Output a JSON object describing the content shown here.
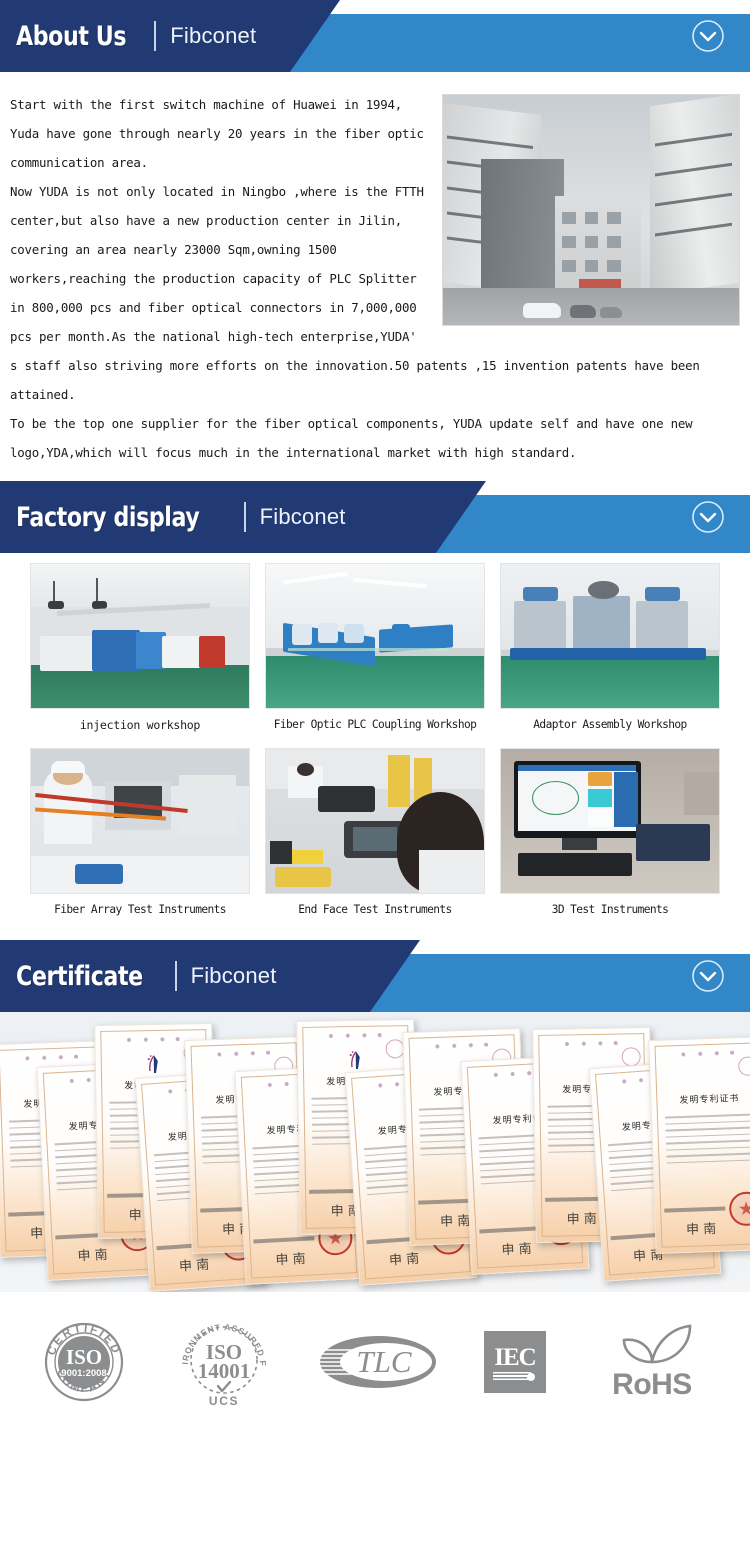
{
  "sections": {
    "about": {
      "title": "About Us",
      "brand": "Fibconet",
      "chevron_icon": "chevron-down-circle-icon",
      "paragraphs": [
        "Start with the first switch machine of Huawei in 1994, Yuda have gone through nearly 20 years in the fiber optic communication area.",
        "Now YUDA is not only located in Ningbo ,where is the FTTH center,but also have a new production center in Jilin, covering an area nearly 23000 Sqm,owning 1500 workers,reaching the production capacity  of  PLC Splitter in 800,000 pcs and fiber optical connectors in 7,000,000 pcs per month.As the national high-tech enterprise,YUDA' s staff also striving more efforts on the innovation.50 patents ,15 invention patents have been attained.",
        "To be the top one supplier for the fiber optical components, YUDA update self and have one new logo,YDA,which will focus much in the international market with high standard."
      ],
      "photo_alt": "factory-buildings-courtyard"
    },
    "factory": {
      "title": "Factory display",
      "brand": "Fibconet",
      "chevron_icon": "chevron-down-circle-icon",
      "items": [
        {
          "caption": "injection workshop",
          "alt": "injection-molding-machines"
        },
        {
          "caption": "Fiber Optic PLC Coupling Workshop",
          "alt": "cleanroom-assembly-line"
        },
        {
          "caption": "Adaptor Assembly Workshop",
          "alt": "adaptor-assembly-machines"
        },
        {
          "caption": "Fiber Array Test Instruments",
          "alt": "worker-at-microscope"
        },
        {
          "caption": "End Face Test Instruments",
          "alt": "workers-end-face-tester"
        },
        {
          "caption": "3D Test Instruments",
          "alt": "monitor-measurement-software"
        }
      ]
    },
    "certificate": {
      "title": "Certificate",
      "brand": "Fibconet",
      "chevron_icon": "chevron-down-circle-icon",
      "wall_alt": "chinese-invention-patent-certificates",
      "certificate_title_cn": "发明专利证书",
      "certificate_count": 12,
      "logos": [
        {
          "name": "iso-9001-logo",
          "line1": "CERTIFIED",
          "line2": "ISO",
          "line3": "9001:2008",
          "line4": "COMPANY"
        },
        {
          "name": "iso-14001-logo",
          "line1": "ENVIRONMENT ASSURED FIRM",
          "line2": "ISO",
          "line3": "14001",
          "line4": "UCS"
        },
        {
          "name": "tlc-logo",
          "line2": "TLC"
        },
        {
          "name": "iec-logo",
          "line2": "IEC"
        },
        {
          "name": "rohs-logo",
          "line2": "RoHS"
        }
      ]
    }
  },
  "colors": {
    "navy": "#223a74",
    "blue": "#3287c8",
    "text": "#1a1a1a",
    "logo_gray": "#8b8d8f",
    "seal_red": "#c0392b"
  }
}
